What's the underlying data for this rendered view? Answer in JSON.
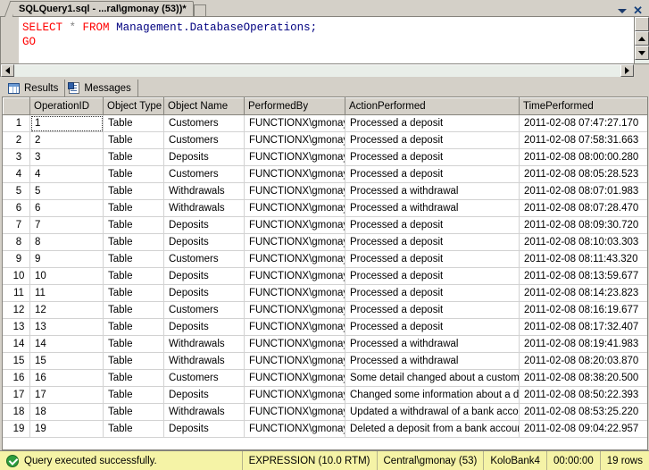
{
  "window": {
    "tab_title": "SQLQuery1.sql - ...ral\\gmonay (53))*",
    "dropdown_icon": "chevron-down-icon",
    "close_icon": "close-icon"
  },
  "editor": {
    "lines": [
      {
        "tokens": [
          {
            "t": "SELECT",
            "c": "kw-red"
          },
          {
            "t": " * ",
            "c": "op"
          },
          {
            "t": "FROM",
            "c": "kw-red"
          },
          {
            "t": " ",
            "c": "plain"
          },
          {
            "t": "Management.DatabaseOperations;",
            "c": "ident"
          }
        ]
      },
      {
        "tokens": [
          {
            "t": "GO",
            "c": "kw-red"
          }
        ]
      }
    ],
    "line1_plain": "SELECT * FROM Management.DatabaseOperations;",
    "line2_plain": "GO"
  },
  "result_tabs": [
    {
      "label": "Results",
      "icon": "grid-icon",
      "active": true
    },
    {
      "label": "Messages",
      "icon": "document-icon",
      "active": false
    }
  ],
  "grid": {
    "columns": [
      "OperationID",
      "Object Type",
      "Object Name",
      "PerformedBy",
      "ActionPerformed",
      "TimePerformed"
    ],
    "rows": [
      {
        "n": "1",
        "OperationID": "1",
        "ObjectType": "Table",
        "ObjectName": "Customers",
        "PerformedBy": "FUNCTIONX\\gmonay",
        "ActionPerformed": "Processed a deposit",
        "TimePerformed": "2011-02-08 07:47:27.170"
      },
      {
        "n": "2",
        "OperationID": "2",
        "ObjectType": "Table",
        "ObjectName": "Customers",
        "PerformedBy": "FUNCTIONX\\gmonay",
        "ActionPerformed": "Processed a deposit",
        "TimePerformed": "2011-02-08 07:58:31.663"
      },
      {
        "n": "3",
        "OperationID": "3",
        "ObjectType": "Table",
        "ObjectName": "Deposits",
        "PerformedBy": "FUNCTIONX\\gmonay",
        "ActionPerformed": "Processed a deposit",
        "TimePerformed": "2011-02-08 08:00:00.280"
      },
      {
        "n": "4",
        "OperationID": "4",
        "ObjectType": "Table",
        "ObjectName": "Customers",
        "PerformedBy": "FUNCTIONX\\gmonay",
        "ActionPerformed": "Processed a deposit",
        "TimePerformed": "2011-02-08 08:05:28.523"
      },
      {
        "n": "5",
        "OperationID": "5",
        "ObjectType": "Table",
        "ObjectName": "Withdrawals",
        "PerformedBy": "FUNCTIONX\\gmonay",
        "ActionPerformed": "Processed a withdrawal",
        "TimePerformed": "2011-02-08 08:07:01.983"
      },
      {
        "n": "6",
        "OperationID": "6",
        "ObjectType": "Table",
        "ObjectName": "Withdrawals",
        "PerformedBy": "FUNCTIONX\\gmonay",
        "ActionPerformed": "Processed a withdrawal",
        "TimePerformed": "2011-02-08 08:07:28.470"
      },
      {
        "n": "7",
        "OperationID": "7",
        "ObjectType": "Table",
        "ObjectName": "Deposits",
        "PerformedBy": "FUNCTIONX\\gmonay",
        "ActionPerformed": "Processed a deposit",
        "TimePerformed": "2011-02-08 08:09:30.720"
      },
      {
        "n": "8",
        "OperationID": "8",
        "ObjectType": "Table",
        "ObjectName": "Deposits",
        "PerformedBy": "FUNCTIONX\\gmonay",
        "ActionPerformed": "Processed a deposit",
        "TimePerformed": "2011-02-08 08:10:03.303"
      },
      {
        "n": "9",
        "OperationID": "9",
        "ObjectType": "Table",
        "ObjectName": "Customers",
        "PerformedBy": "FUNCTIONX\\gmonay",
        "ActionPerformed": "Processed a deposit",
        "TimePerformed": "2011-02-08 08:11:43.320"
      },
      {
        "n": "10",
        "OperationID": "10",
        "ObjectType": "Table",
        "ObjectName": "Deposits",
        "PerformedBy": "FUNCTIONX\\gmonay",
        "ActionPerformed": "Processed a deposit",
        "TimePerformed": "2011-02-08 08:13:59.677"
      },
      {
        "n": "11",
        "OperationID": "11",
        "ObjectType": "Table",
        "ObjectName": "Deposits",
        "PerformedBy": "FUNCTIONX\\gmonay",
        "ActionPerformed": "Processed a deposit",
        "TimePerformed": "2011-02-08 08:14:23.823"
      },
      {
        "n": "12",
        "OperationID": "12",
        "ObjectType": "Table",
        "ObjectName": "Customers",
        "PerformedBy": "FUNCTIONX\\gmonay",
        "ActionPerformed": "Processed a deposit",
        "TimePerformed": "2011-02-08 08:16:19.677"
      },
      {
        "n": "13",
        "OperationID": "13",
        "ObjectType": "Table",
        "ObjectName": "Deposits",
        "PerformedBy": "FUNCTIONX\\gmonay",
        "ActionPerformed": "Processed a deposit",
        "TimePerformed": "2011-02-08 08:17:32.407"
      },
      {
        "n": "14",
        "OperationID": "14",
        "ObjectType": "Table",
        "ObjectName": "Withdrawals",
        "PerformedBy": "FUNCTIONX\\gmonay",
        "ActionPerformed": "Processed a withdrawal",
        "TimePerformed": "2011-02-08 08:19:41.983"
      },
      {
        "n": "15",
        "OperationID": "15",
        "ObjectType": "Table",
        "ObjectName": "Withdrawals",
        "PerformedBy": "FUNCTIONX\\gmonay",
        "ActionPerformed": "Processed a withdrawal",
        "TimePerformed": "2011-02-08 08:20:03.870"
      },
      {
        "n": "16",
        "OperationID": "16",
        "ObjectType": "Table",
        "ObjectName": "Customers",
        "PerformedBy": "FUNCTIONX\\gmonay",
        "ActionPerformed": "Some detail changed about a customer",
        "TimePerformed": "2011-02-08 08:38:20.500"
      },
      {
        "n": "17",
        "OperationID": "17",
        "ObjectType": "Table",
        "ObjectName": "Deposits",
        "PerformedBy": "FUNCTIONX\\gmonay",
        "ActionPerformed": "Changed some information about a de...",
        "TimePerformed": "2011-02-08 08:50:22.393"
      },
      {
        "n": "18",
        "OperationID": "18",
        "ObjectType": "Table",
        "ObjectName": "Withdrawals",
        "PerformedBy": "FUNCTIONX\\gmonay",
        "ActionPerformed": "Updated a withdrawal of a bank acco...",
        "TimePerformed": "2011-02-08 08:53:25.220"
      },
      {
        "n": "19",
        "OperationID": "19",
        "ObjectType": "Table",
        "ObjectName": "Deposits",
        "PerformedBy": "FUNCTIONX\\gmonay",
        "ActionPerformed": "Deleted a deposit from a bank account.",
        "TimePerformed": "2011-02-08 09:04:22.957"
      }
    ],
    "selected_cell": {
      "row": 0,
      "column": "OperationID"
    }
  },
  "statusbar": {
    "icon": "success-check-icon",
    "message": "Query executed successfully.",
    "server": "EXPRESSION (10.0 RTM)",
    "user": "Central\\gmonay (53)",
    "database": "KoloBank4",
    "elapsed": "00:00:00",
    "rowcount": "19 rows"
  },
  "colors": {
    "chrome": "#d4d0c8",
    "statusbar_bg": "#f5f3a6",
    "success_green": "#2e9e3e",
    "selection_blue": "#b0bdd8",
    "keyword_red": "#ff0000",
    "identifier_blue": "#000080"
  }
}
